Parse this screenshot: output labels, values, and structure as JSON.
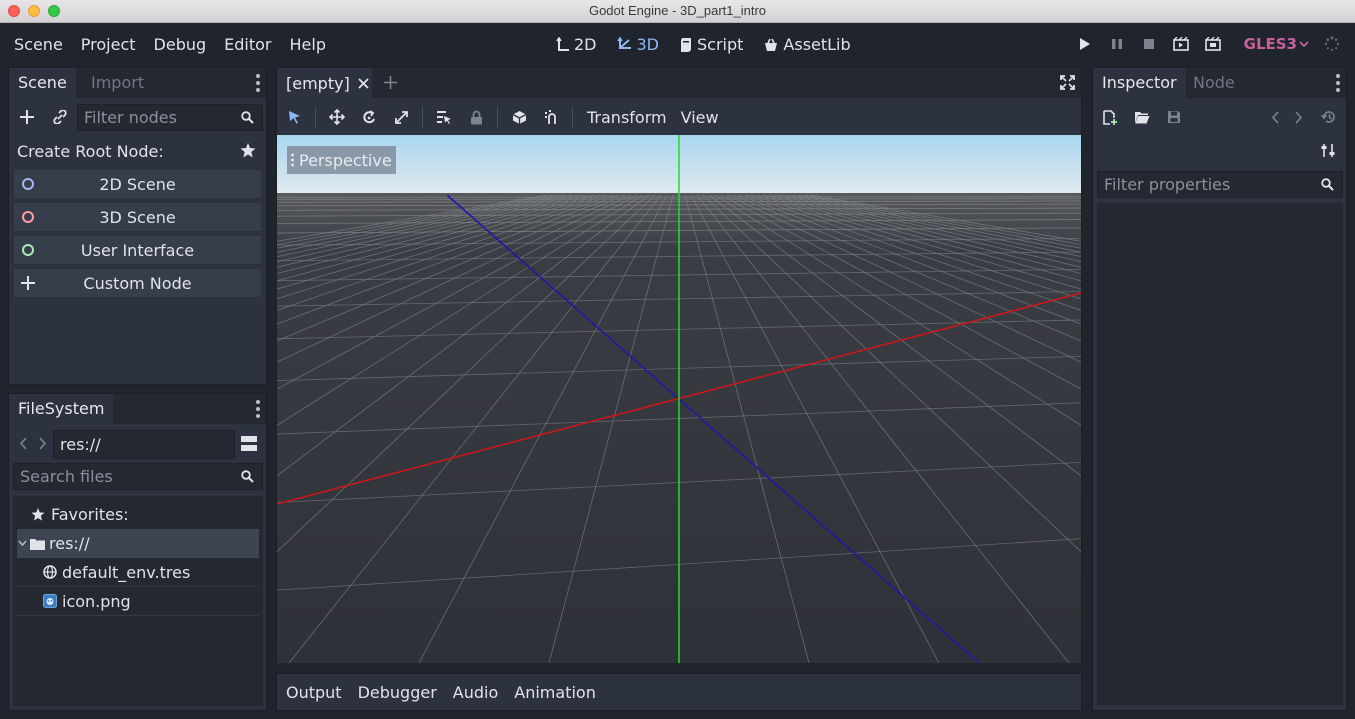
{
  "window": {
    "title": "Godot Engine - 3D_part1_intro"
  },
  "menu": {
    "items": [
      "Scene",
      "Project",
      "Debug",
      "Editor",
      "Help"
    ],
    "workspaces": [
      {
        "label": "2D",
        "icon": "2d-workspace-icon"
      },
      {
        "label": "3D",
        "icon": "3d-workspace-icon",
        "active": true
      },
      {
        "label": "Script",
        "icon": "script-icon"
      },
      {
        "label": "AssetLib",
        "icon": "assetlib-icon"
      }
    ],
    "renderer": "GLES3"
  },
  "scene_dock": {
    "tabs": [
      "Scene",
      "Import"
    ],
    "filter_placeholder": "Filter nodes",
    "create_root_label": "Create Root Node:",
    "root_options": [
      {
        "label": "2D Scene",
        "color": "#a5b7f3"
      },
      {
        "label": "3D Scene",
        "color": "#fc9c9c"
      },
      {
        "label": "User Interface",
        "color": "#a5efac"
      },
      {
        "label": "Custom Node",
        "color": "#e0e3e8"
      }
    ]
  },
  "filesystem_dock": {
    "tab": "FileSystem",
    "path": "res://",
    "search_placeholder": "Search files",
    "favorites_label": "Favorites:",
    "root_folder": "res://",
    "files": [
      "default_env.tres",
      "icon.png"
    ]
  },
  "viewport": {
    "scene_tab": "[empty]",
    "menus": [
      "Transform",
      "View"
    ],
    "camera_label": "Perspective",
    "colors": {
      "x_axis": "#d41515",
      "y_axis": "#22dd22",
      "z_axis": "#1a1aa8",
      "sky_top": "#a9d6ef",
      "sky_bottom": "#dfe9ef",
      "ground": "#2e3137"
    }
  },
  "bottom_panel": {
    "tabs": [
      "Output",
      "Debugger",
      "Audio",
      "Animation"
    ]
  },
  "inspector_dock": {
    "tabs": [
      "Inspector",
      "Node"
    ],
    "filter_placeholder": "Filter properties"
  }
}
